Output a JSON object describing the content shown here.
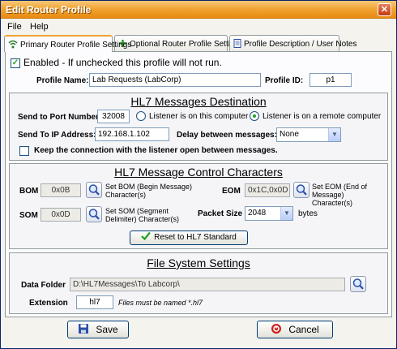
{
  "window": {
    "title": "Edit Router Profile",
    "close_glyph": "✕"
  },
  "menu": {
    "items": [
      "File",
      "Help"
    ]
  },
  "tabs": [
    {
      "label": "Primary Router Profile Settings",
      "icon": "wifi-icon"
    },
    {
      "label": "Optional Router Profile Settings",
      "icon": "plus-icon"
    },
    {
      "label": "Profile Description / User Notes",
      "icon": "document-icon"
    }
  ],
  "general": {
    "enabled_label": "Enabled - If unchecked this profile will not run.",
    "enabled_checked": true,
    "profile_name_label": "Profile Name:",
    "profile_name_value": "Lab Requests (LabCorp)",
    "profile_id_label": "Profile ID:",
    "profile_id_value": "p1"
  },
  "destination": {
    "title": "HL7 Messages Destination",
    "port_label": "Send to Port Number:",
    "port_value": "32008",
    "radio_local": "Listener is on this computer",
    "radio_remote": "Listener is on a remote computer",
    "selected_radio": "remote",
    "ip_label": "Send To IP Address:",
    "ip_value": "192.168.1.102",
    "delay_label": "Delay between messages:",
    "delay_value": "None",
    "keep_open_label": "Keep the connection with the listener open between messages.",
    "keep_open_checked": false
  },
  "control_chars": {
    "title": "HL7 Message Control Characters",
    "bom_label": "BOM",
    "bom_value": "0x0B",
    "bom_desc": "Set BOM (Begin Message) Character(s)",
    "eom_label": "EOM",
    "eom_value": "0x1C,0x0D",
    "eom_desc": "Set EOM (End of Message) Character(s)",
    "som_label": "SOM",
    "som_value": "0x0D",
    "som_desc": "Set SOM (Segment Delimiter) Character(s)",
    "packet_label": "Packet Size",
    "packet_value": "2048",
    "packet_unit": "bytes",
    "reset_label": "Reset to HL7 Standard"
  },
  "filesystem": {
    "title": "File System Settings",
    "folder_label": "Data Folder",
    "folder_value": "D:\\HL7Messages\\To Labcorp\\",
    "extension_label": "Extension",
    "extension_value": "hl7",
    "extension_note": "Files must be named *.hl7"
  },
  "footer": {
    "save_label": "Save",
    "cancel_label": "Cancel"
  },
  "colors": {
    "title_bar": "#f0a330",
    "save_icon": "#2a4ea8",
    "cancel_icon": "#d0201c",
    "check": "#21a121"
  }
}
